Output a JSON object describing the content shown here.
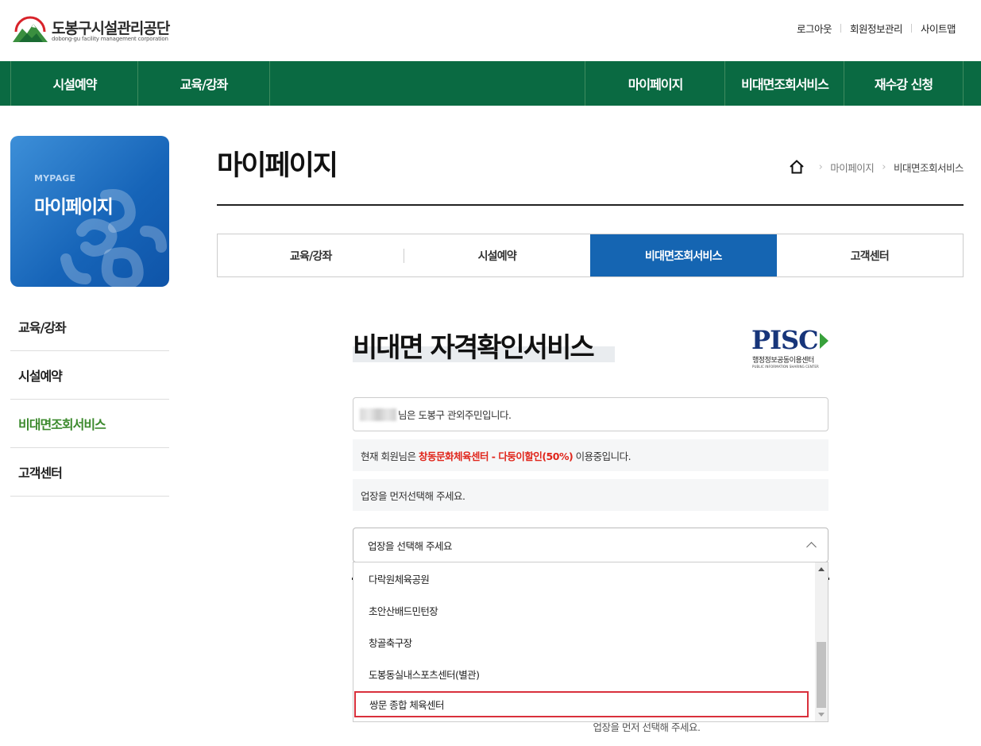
{
  "header": {
    "logo_title": "도봉구시설관리공단",
    "logo_subtitle": "dobong-gu facility management corporation",
    "util_links": [
      "로그아웃",
      "회원정보관리",
      "사이트맵"
    ]
  },
  "gnb": {
    "items": [
      "시설예약",
      "교육/강좌",
      "마이페이지",
      "비대면조회서비스",
      "재수강 신청"
    ]
  },
  "sidebar": {
    "card_eng": "MYPAGE",
    "card_title": "마이페이지",
    "items": [
      {
        "label": "교육/강좌",
        "active": false
      },
      {
        "label": "시설예약",
        "active": false
      },
      {
        "label": "비대면조회서비스",
        "active": true
      },
      {
        "label": "고객센터",
        "active": false
      }
    ]
  },
  "page": {
    "title": "마이페이지",
    "breadcrumb": [
      "마이페이지",
      "비대면조회서비스"
    ]
  },
  "tabs": [
    {
      "label": "교육/강좌",
      "active": false
    },
    {
      "label": "시설예약",
      "active": false
    },
    {
      "label": "비대면조회서비스",
      "active": true
    },
    {
      "label": "고객센터",
      "active": false
    }
  ],
  "service": {
    "title": "비대면 자격확인서비스",
    "pisc_logo": "PISC",
    "pisc_kor": "행정정보공동이용센터",
    "pisc_eng": "PUBLIC INFORMATION SHARING CENTER",
    "resident_msg": "님은 도봉구 관외주민입니다.",
    "member_prefix": "현재 회원님은 ",
    "member_highlight": "창동문화체육센터 - 다둥이할인(50%)",
    "member_suffix": " 이용중입니다.",
    "select_first_msg": "업장을 먼저선택해 주세요.",
    "select_placeholder": "업장을 선택해 주세요",
    "options": [
      "다락원체육공원",
      "초안산배드민턴장",
      "창골축구장",
      "도봉동실내스포츠센터(별관)",
      "쌍문 종합 체육센터"
    ],
    "highlighted_option": "쌍문 종합 체육센터",
    "behind_note": "업장을 먼저 선택해 주세요."
  },
  "colors": {
    "gnb_bg": "#0a6a42",
    "tab_active": "#1565b2",
    "sidebar_active": "#3d8a2e",
    "highlight_text": "#e0251b",
    "highlight_border": "#d9303c"
  }
}
